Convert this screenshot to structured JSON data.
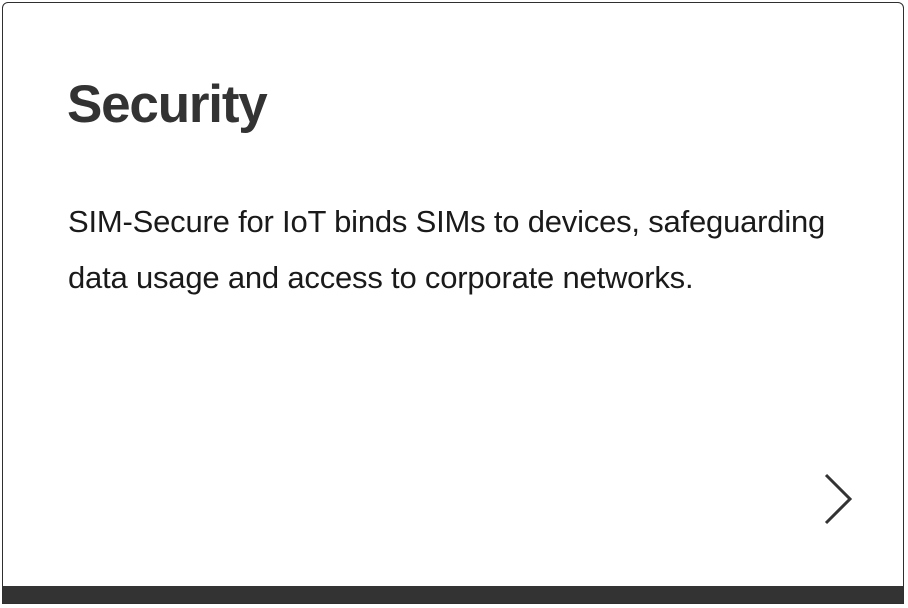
{
  "card": {
    "title": "Security",
    "description": "SIM-Secure for IoT binds SIMs to devices, safeguarding data usage and access to corporate networks.",
    "icon": "chevron-right-icon"
  },
  "colors": {
    "title": "#333333",
    "text": "#1a1a1a",
    "border": "#2f2f2f",
    "bottom_bar": "#333333",
    "background": "#ffffff"
  }
}
